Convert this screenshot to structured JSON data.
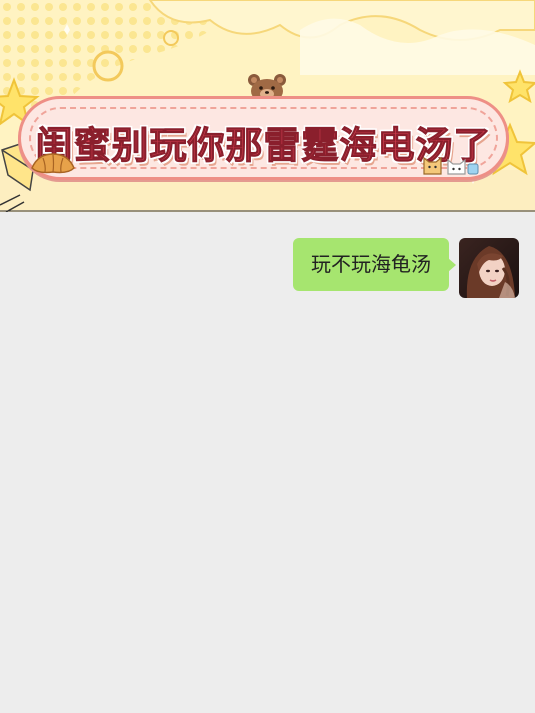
{
  "banner": {
    "title": "闺蜜别玩你那雷霆海电汤了",
    "colors": {
      "background": "#fff1b8",
      "title": "#cf3c4e",
      "pill_border": "#ee8f86",
      "star": "#ffe36a"
    },
    "decorations": [
      "bear-icon",
      "croissant-icon",
      "cat-icon",
      "star-icon"
    ]
  },
  "chat": {
    "background": "#ededed",
    "messages": [
      {
        "side": "right",
        "text": "玩不玩海龟汤",
        "bubble_color": "#a6e56f",
        "avatar": "user-avatar"
      }
    ]
  }
}
